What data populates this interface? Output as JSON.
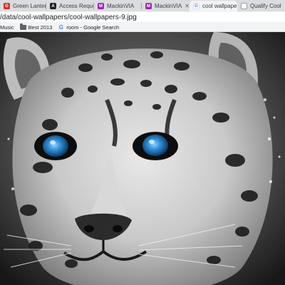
{
  "tabs": [
    {
      "title": "Green Lantern",
      "favicon_color": "#d93025",
      "favicon_glyph": "G"
    },
    {
      "title": "Access Reques",
      "favicon_color": "#202124",
      "favicon_glyph": "A"
    },
    {
      "title": "MackinVIA",
      "favicon_color": "#9c27b0",
      "favicon_glyph": "M"
    },
    {
      "title": "MackinVIA",
      "favicon_color": "#9c27b0",
      "favicon_glyph": "M"
    },
    {
      "title": "cool wallpape",
      "favicon_color": "#4285f4",
      "favicon_glyph": "G"
    },
    {
      "title": "Qualify Cool",
      "favicon_color": "#ffffff",
      "favicon_glyph": "Q"
    }
  ],
  "address": {
    "url": "/data/cool-wallpapers/cool-wallpapers-9.jpg"
  },
  "bookmarks": [
    {
      "label": "Music",
      "icon": "folder-icon"
    },
    {
      "label": "Best 2013",
      "icon": "folder-icon"
    },
    {
      "label": "room - Google Search",
      "icon": "google-icon"
    }
  ],
  "image": {
    "subject": "snow-leopard-photo",
    "eye_color": "#2f8fd8"
  }
}
